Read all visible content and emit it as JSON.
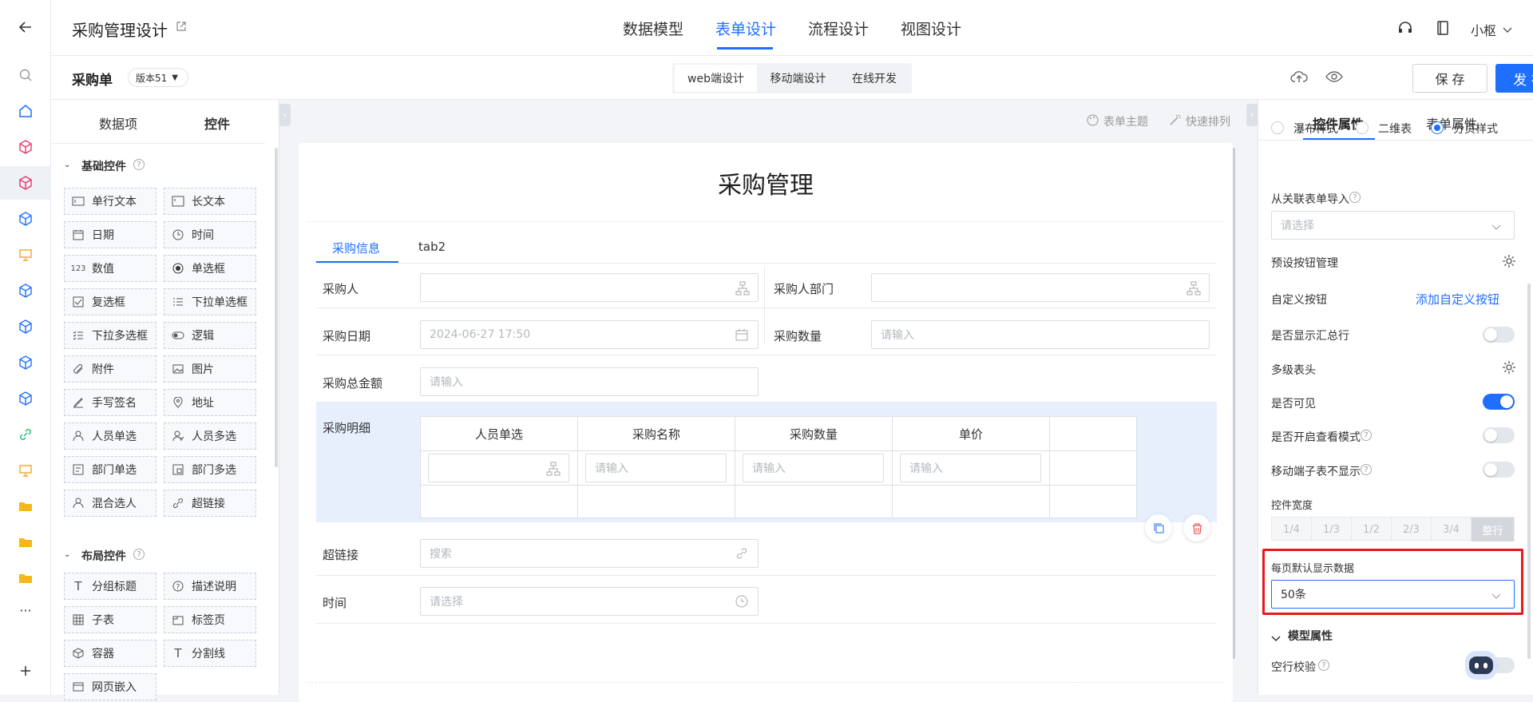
{
  "topbar": {
    "app_title": "采购管理设计",
    "tabs": [
      "数据模型",
      "表单设计",
      "流程设计",
      "视图设计"
    ],
    "user": "小枢"
  },
  "subbar": {
    "form_name": "采购单",
    "version": "版本51",
    "design_modes": [
      "web端设计",
      "移动端设计",
      "在线开发"
    ],
    "save_label": "保 存",
    "publish_label": "发 布"
  },
  "left_panel": {
    "tabs": [
      "数据项",
      "控件"
    ],
    "basic_section": "基础控件",
    "basic_controls": [
      "单行文本",
      "长文本",
      "日期",
      "时间",
      "数值",
      "单选框",
      "复选框",
      "下拉单选框",
      "下拉多选框",
      "逻辑",
      "附件",
      "图片",
      "手写签名",
      "地址",
      "人员单选",
      "人员多选",
      "部门单选",
      "部门多选",
      "混合选人",
      "超链接"
    ],
    "layout_section": "布局控件",
    "layout_controls": [
      "分组标题",
      "描述说明",
      "子表",
      "标签页",
      "容器",
      "分割线",
      "网页嵌入"
    ]
  },
  "canvas": {
    "theme_label": "表单主题",
    "quick_sort_label": "快速排列",
    "form_title": "采购管理",
    "tabs": [
      "采购信息",
      "tab2"
    ],
    "fields": {
      "buyer": {
        "label": "采购人"
      },
      "buyer_dept": {
        "label": "采购人部门"
      },
      "date": {
        "label": "采购日期",
        "value": "2024-06-27 17:50"
      },
      "quantity": {
        "label": "采购数量",
        "placeholder": "请输入"
      },
      "total": {
        "label": "采购总金额",
        "placeholder": "请输入"
      },
      "detail": {
        "label": "采购明细"
      },
      "link": {
        "label": "超链接",
        "placeholder": "搜索"
      },
      "time": {
        "label": "时间",
        "placeholder": "请选择"
      }
    },
    "subtable": {
      "columns": [
        "人员单选",
        "采购名称",
        "采购数量",
        "单价"
      ],
      "placeholder": "请输入"
    }
  },
  "right_panel": {
    "tabs": [
      "控件属性",
      "表单属性"
    ],
    "style_options": [
      "瀑布样式",
      "二维表",
      "分页样式"
    ],
    "selected_style": "分页样式",
    "import_label": "从关联表单导入",
    "import_placeholder": "请选择",
    "preset_buttons": "预设按钮管理",
    "custom_buttons": "自定义按钮",
    "add_custom_button": "添加自定义按钮",
    "show_summary": {
      "label": "是否显示汇总行",
      "on": false
    },
    "multi_header": "多级表头",
    "visible": {
      "label": "是否可见",
      "on": true
    },
    "view_mode": {
      "label": "是否开启查看模式",
      "on": false
    },
    "mobile_hide": {
      "label": "移动端子表不显示",
      "on": false
    },
    "width_label": "控件宽度",
    "width_options": [
      "1/4",
      "1/3",
      "1/2",
      "2/3",
      "3/4",
      "整行"
    ],
    "page_size_label": "每页默认显示数据",
    "page_size_value": "50条",
    "model_section": "模型属性",
    "blank_row_check": "空行校验"
  },
  "colors": {
    "accent": "#1e6fff",
    "highlight": "#e8191a",
    "danger": "#e53935"
  }
}
